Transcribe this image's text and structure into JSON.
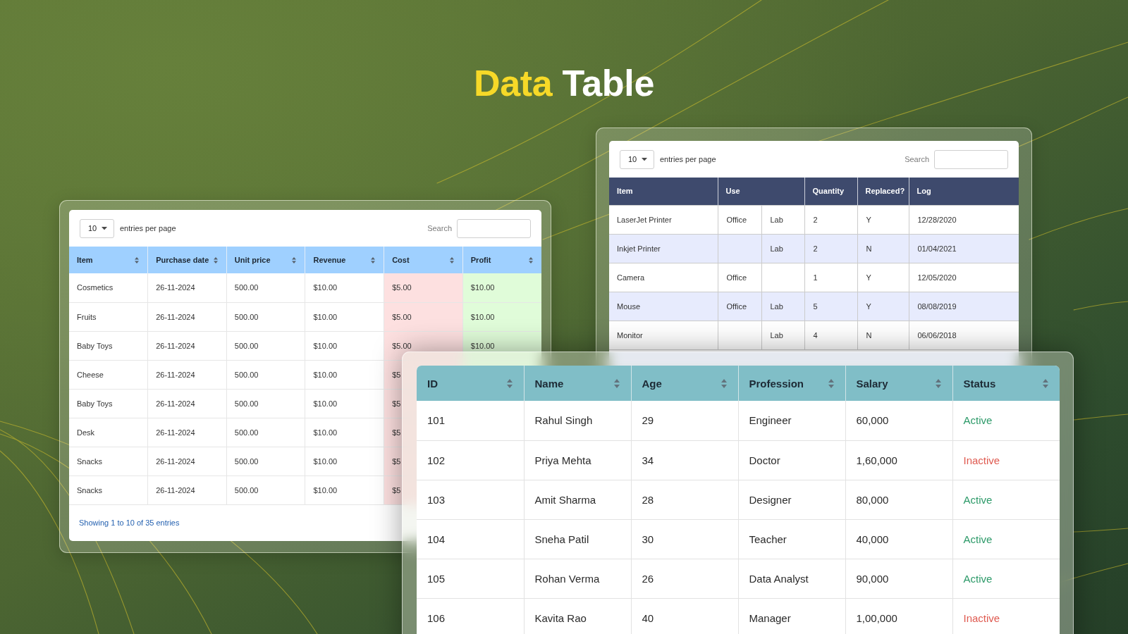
{
  "title": {
    "accent": "Data",
    "text": "Table"
  },
  "product_table": {
    "page_size": "10",
    "page_size_label": "entries per page",
    "search_label": "Search",
    "columns": [
      {
        "label": "Item",
        "sortable": true
      },
      {
        "label": "Purchase date",
        "sortable": true
      },
      {
        "label": "Unit price",
        "sortable": true
      },
      {
        "label": "Revenue",
        "sortable": true
      },
      {
        "label": "Cost",
        "sortable": true,
        "color": "#fde0e0"
      },
      {
        "label": "Profit",
        "sortable": true,
        "color": "#e0fcd9"
      }
    ],
    "rows": [
      {
        "cells": [
          "Cosmetics",
          "26-11-2024",
          "500.00",
          "$10.00",
          "$5.00",
          "$10.00"
        ]
      },
      {
        "cells": [
          "Fruits",
          "26-11-2024",
          "500.00",
          "$10.00",
          "$5.00",
          "$10.00"
        ]
      },
      {
        "cells": [
          "Baby Toys",
          "26-11-2024",
          "500.00",
          "$10.00",
          "$5.00",
          "$10.00"
        ]
      },
      {
        "cells": [
          "Cheese",
          "26-11-2024",
          "500.00",
          "$10.00",
          "$5"
        ]
      },
      {
        "cells": [
          "Baby Toys",
          "26-11-2024",
          "500.00",
          "$10.00",
          "$5"
        ]
      },
      {
        "cells": [
          "Desk",
          "26-11-2024",
          "500.00",
          "$10.00",
          "$5"
        ]
      },
      {
        "cells": [
          "Snacks",
          "26-11-2024",
          "500.00",
          "$10.00",
          "$5"
        ]
      },
      {
        "cells": [
          "Snacks",
          "26-11-2024",
          "500.00",
          "$10.00",
          "$5"
        ]
      }
    ],
    "footer": "Showing 1 to 10 of 35 entries"
  },
  "equipment_table": {
    "page_size": "10",
    "page_size_label": "entries per page",
    "search_label": "Search",
    "columns": [
      {
        "label": "Item",
        "sortable": false
      },
      {
        "label": "Use",
        "sortable": false
      },
      {
        "label": "Quantity",
        "sortable": false
      },
      {
        "label": "Replaced?",
        "sortable": false
      },
      {
        "label": "Log",
        "sortable": false
      }
    ],
    "rows": [
      {
        "cells": [
          "LaserJet Printer",
          [
            "Office",
            "Lab"
          ],
          "2",
          "Y",
          "12/28/2020"
        ]
      },
      {
        "cells": [
          "Inkjet Printer",
          [
            null,
            "Lab"
          ],
          "2",
          "N",
          "01/04/2021"
        ]
      },
      {
        "cells": [
          "Camera",
          [
            "Office",
            null
          ],
          "1",
          "Y",
          "12/05/2020"
        ]
      },
      {
        "cells": [
          "Mouse",
          [
            "Office",
            "Lab"
          ],
          "5",
          "Y",
          "08/08/2019"
        ]
      },
      {
        "cells": [
          "Monitor",
          [
            null,
            "Lab"
          ],
          "4",
          "N",
          "06/06/2018"
        ]
      }
    ]
  },
  "employee_table": {
    "columns": [
      {
        "label": "ID",
        "sortable": true
      },
      {
        "label": "Name",
        "sortable": true
      },
      {
        "label": "Age",
        "sortable": true
      },
      {
        "label": "Profession",
        "sortable": true
      },
      {
        "label": "Salary",
        "sortable": true
      },
      {
        "label": "Status",
        "sortable": true
      }
    ],
    "rows": [
      {
        "cells": [
          "101",
          "Rahul Singh",
          "29",
          "Engineer",
          "60,000"
        ],
        "status": {
          "text": "Active",
          "active": true
        }
      },
      {
        "cells": [
          "102",
          "Priya Mehta",
          "34",
          "Doctor",
          "1,60,000"
        ],
        "status": {
          "text": "Inactive",
          "active": false
        }
      },
      {
        "cells": [
          "103",
          "Amit Sharma",
          "28",
          "Designer",
          "80,000"
        ],
        "status": {
          "text": "Active",
          "active": true
        }
      },
      {
        "cells": [
          "104",
          "Sneha Patil",
          "30",
          "Teacher",
          "40,000"
        ],
        "status": {
          "text": "Active",
          "active": true
        }
      },
      {
        "cells": [
          "105",
          "Rohan Verma",
          "26",
          "Data Analyst",
          "90,000"
        ],
        "status": {
          "text": "Active",
          "active": true
        }
      },
      {
        "cells": [
          "106",
          "Kavita Rao",
          "40",
          "Manager",
          "1,00,000"
        ],
        "status": {
          "text": "Inactive",
          "active": false
        }
      }
    ]
  }
}
